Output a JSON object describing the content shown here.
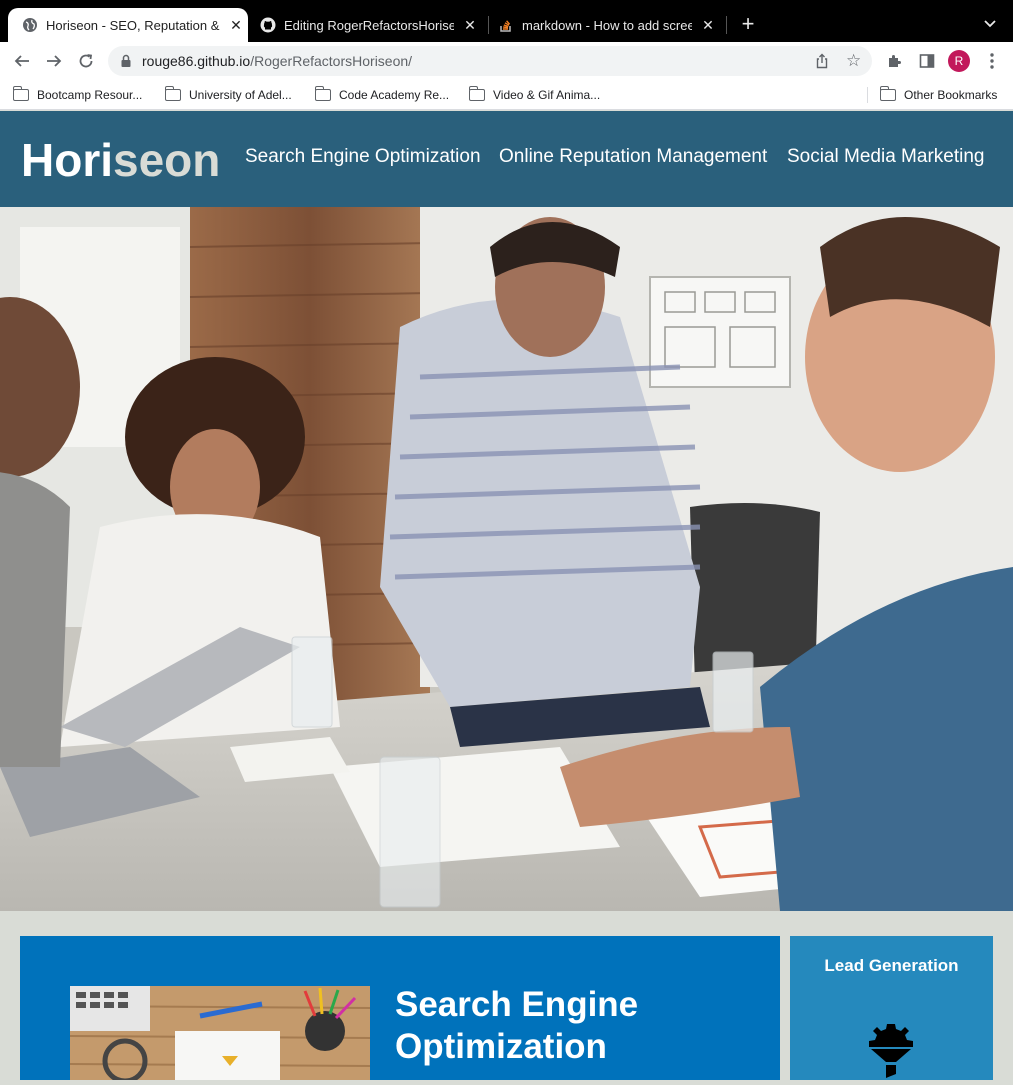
{
  "browser": {
    "tabs": [
      {
        "title": "Horiseon - SEO, Reputation & Marketing",
        "active": true,
        "favicon": "globe-icon"
      },
      {
        "title": "Editing RogerRefactorsHoriseon",
        "active": false,
        "favicon": "github-icon"
      },
      {
        "title": "markdown - How to add screenshot",
        "active": false,
        "favicon": "stackoverflow-icon"
      }
    ],
    "close_glyph": "✕",
    "new_tab_glyph": "+",
    "url_host": "rouge86.github.io",
    "url_path": "/RogerRefactorsHoriseon/",
    "profile_initial": "R",
    "profile_color": "#c2185b",
    "bookmarks": [
      "Bootcamp Resour...",
      "University of Adel...",
      "Code Academy Re...",
      "Video & Gif Anima..."
    ],
    "other_bookmarks": "Other Bookmarks"
  },
  "site": {
    "logo_part1": "Hori",
    "logo_part2": "seon",
    "nav": [
      "Search Engine Optimization",
      "Online Reputation Management",
      "Social Media Marketing"
    ],
    "header_color": "#2a607c",
    "hero_alt": "hero image of team meeting",
    "section_title": "Search Engine Optimization",
    "section_color": "#0072bb",
    "aside_title": "Lead Generation",
    "aside_color": "#2589bd"
  }
}
